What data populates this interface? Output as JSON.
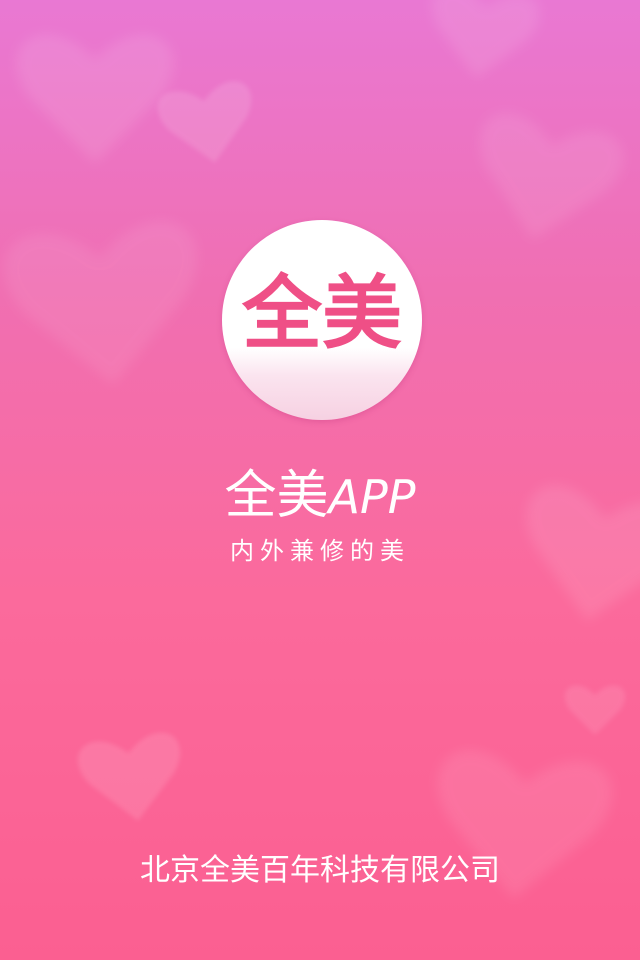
{
  "splash": {
    "logo_text": "全美",
    "app_name_cn": "全美",
    "app_name_latin": "APP",
    "tagline": "内外兼修的美",
    "company": "北京全美百年科技有限公司"
  },
  "colors": {
    "background_top": "#e978d3",
    "background_bottom": "#fb5f91",
    "logo_text": "#ef4f86",
    "text": "#ffffff"
  },
  "icons": [
    "heart-icon"
  ]
}
